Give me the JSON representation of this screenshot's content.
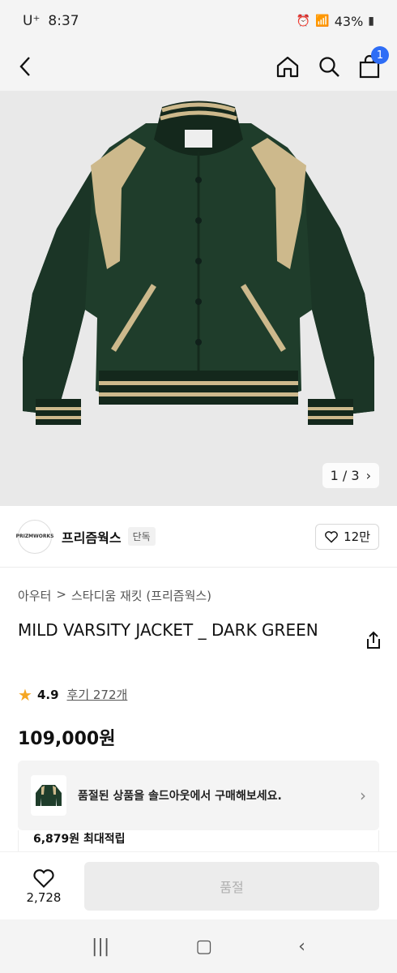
{
  "status_bar": {
    "carrier": "U⁺",
    "time": "8:37",
    "battery": "43%"
  },
  "nav": {
    "cart_count": "1"
  },
  "gallery": {
    "current": "1",
    "separator": "/",
    "total": "3"
  },
  "brand": {
    "logo_text": "PRIZMWORKS",
    "name": "프리즘웍스",
    "tag": "단독",
    "likes": "12만"
  },
  "breadcrumb": {
    "category": "아우터",
    "separator": ">",
    "subcategory": "스타디움 재킷 (프리즘웍스)"
  },
  "product": {
    "title": "MILD VARSITY JACKET _ DARK GREEN",
    "rating": "4.9",
    "reviews": "후기 272개",
    "price": "109,000원"
  },
  "promo": {
    "text": "품절된 상품을 솔드아웃에서 구매해보세요."
  },
  "points": {
    "text": "6,879원 최대적립"
  },
  "bottom": {
    "wish_count": "2,728",
    "buy_label": "품절"
  },
  "colors": {
    "jacket_green": "#1f3d2b",
    "jacket_tan": "#cdb98c",
    "badge_blue": "#2e6df6",
    "star": "#f5a623"
  }
}
